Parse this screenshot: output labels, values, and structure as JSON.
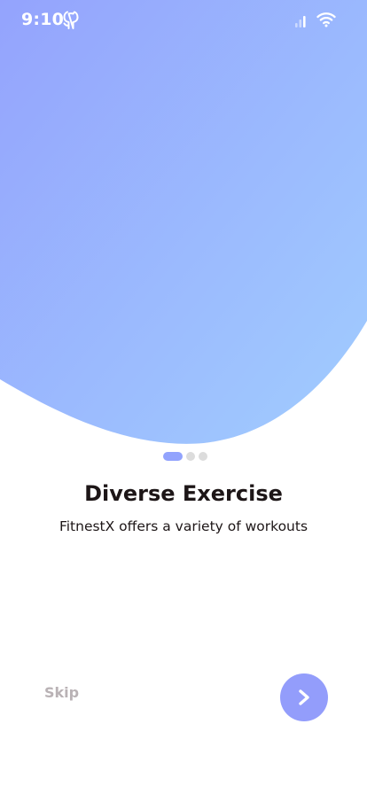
{
  "status_bar": {
    "time": "9:10"
  },
  "icons": {
    "app_icon": "github-icon",
    "signal": "cellular-signal-icon",
    "wifi": "wifi-icon",
    "next": "chevron-right-icon"
  },
  "colors": {
    "gradient_start": "#94a3fd",
    "gradient_end": "#a1cdfe",
    "accent": "#92a3fd",
    "button": "#939dfb",
    "skip_text": "#b9b2b5",
    "text": "#1d1617"
  },
  "pager": {
    "total": 3,
    "current": 1
  },
  "onboarding": {
    "title": "Diverse Exercise",
    "subtitle": "FitnestX offers a variety of workouts",
    "skip_label": "Skip"
  }
}
